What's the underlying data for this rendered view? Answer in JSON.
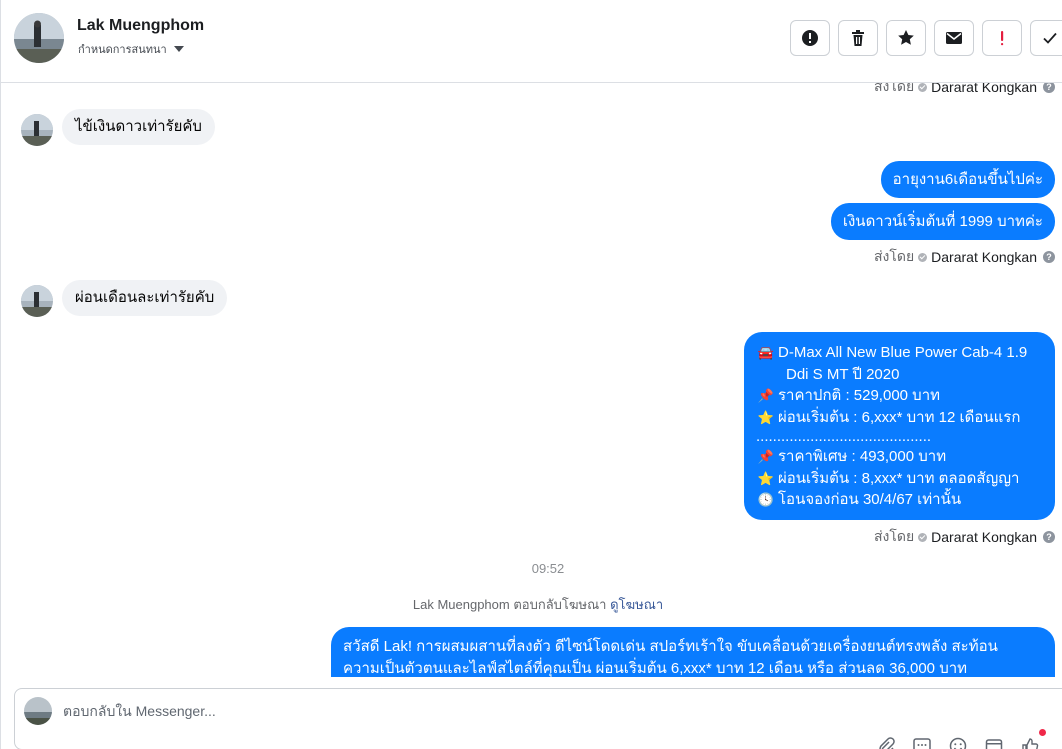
{
  "header": {
    "name": "Lak Muengphom",
    "assign_label": "กำหนดการสนทนา",
    "toolbar": [
      {
        "icon": "alert-circle-icon"
      },
      {
        "icon": "trash-icon"
      },
      {
        "icon": "star-icon"
      },
      {
        "icon": "mail-icon"
      },
      {
        "icon": "exclamation-icon"
      },
      {
        "icon": "check-icon"
      }
    ]
  },
  "sent_by": {
    "prefix": "ส่งโดย",
    "agent": "Dararat Kongkan"
  },
  "messages": {
    "in_1": "ไข้เงินดาวเท่ารัยคับ",
    "out_1": "อายุงาน6เดือนขึ้นไปค่ะ",
    "out_2": "เงินดาวน์เริ่มต้นที่ 1999 บาทค่ะ",
    "in_2": "ผ่อนเดือนละเท่ารัยคับ",
    "promo": {
      "line1": "D-Max All New Blue Power Cab-4 1.9",
      "line2": "Ddi S MT  ปี 2020",
      "line3": "ราคาปกติ : 529,000 บาท",
      "line4": "ผ่อนเริ่มต้น : 6,xxx* บาท 12 เดือนแรก",
      "divider": "..........................................",
      "line5": "ราคาพิเศษ : 493,000 บาท",
      "line6": "ผ่อนเริ่มต้น : 8,xxx* บาท ตลอดสัญญา",
      "line7": "โอนจองก่อน 30/4/67 เท่านั้น"
    },
    "timestamp": "09:52",
    "ad_reply_text": "Lak Muengphom ตอบกลับโฆษณา",
    "ad_reply_link": "ดูโฆษณา",
    "ad_line1": "สวัสดี Lak! การผสมผสานที่ลงตัว ดีไซน์โดดเด่น สปอร์ทเร้าใจ ขับเคลื่อนด้วยเครื่องยนต์ทรงพลัง สะท้อน",
    "ad_line2": "ความเป็นตัวตนและไลฟ์สไตล์ที่คุณเป็น ผ่อนเริ่มต้น 6,xxx* บาท 12 เดือน หรือ ส่วนลด 36,000 บาท"
  },
  "composer": {
    "placeholder": "ตอบกลับใน Messenger..."
  },
  "colors": {
    "outgoing": "#0a7cff",
    "incoming": "#f0f2f5"
  }
}
